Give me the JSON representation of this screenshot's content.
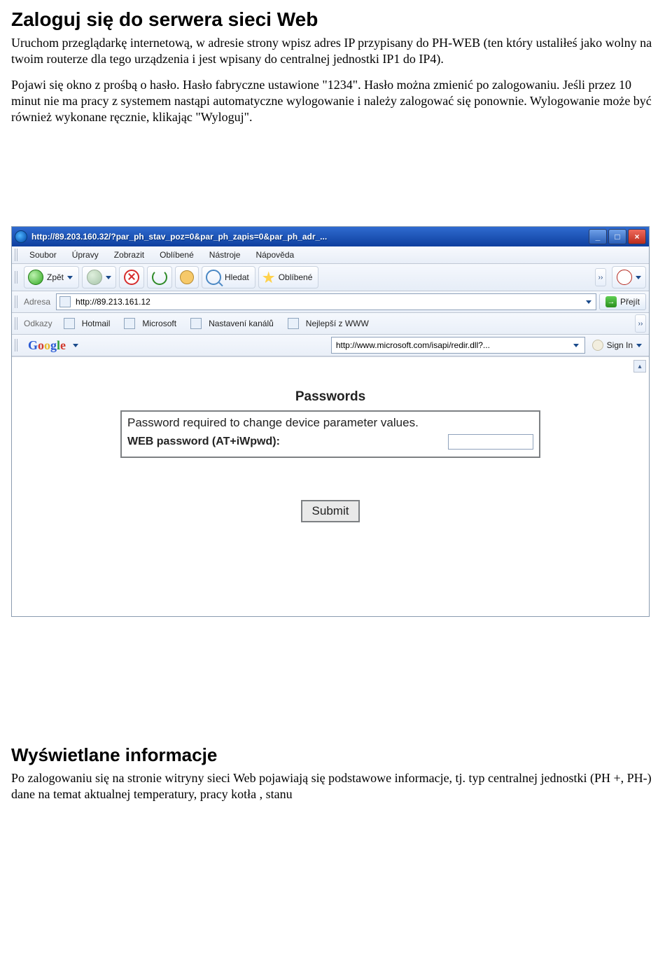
{
  "heading1": "Zaloguj się do serwera sieci Web",
  "paragraph1": "Uruchom przeglądarkę internetową, w adresie strony wpisz adres IP przypisany do PH-WEB (ten który ustaliłeś jako wolny na twoim routerze dla tego urządzenia i jest wpisany do centralnej jednostki  IP1 do IP4).",
  "paragraph2": "Pojawi się okno z prośbą o hasło. Hasło fabryczne ustawione \"1234\". Hasło można zmienić po zalogowaniu. Jeśli  przez 10 minut nie ma pracy z systemem nastąpi automatyczne wylogowanie i należy zalogować się ponownie. Wylogowanie może być również wykonane ręcznie, klikając \"Wyloguj\".",
  "browser": {
    "title": "http://89.203.160.32/?par_ph_stav_poz=0&par_ph_zapis=0&par_ph_adr_...",
    "menu": [
      "Soubor",
      "Úpravy",
      "Zobrazit",
      "Oblíbené",
      "Nástroje",
      "Nápověda"
    ],
    "back": "Zpět",
    "search": "Hledat",
    "favorites": "Oblíbené",
    "addr_label": "Adresa",
    "addr_value": "http://89.213.161.12",
    "go": "Přejít",
    "links_label": "Odkazy",
    "links": [
      "Hotmail",
      "Microsoft",
      "Nastavení kanálů",
      "Nejlepší z WWW"
    ],
    "google_value": "http://www.microsoft.com/isapi/redir.dll?...",
    "signin": "Sign In"
  },
  "passwords": {
    "title": "Passwords",
    "desc": "Password required to change device parameter values.",
    "label": "WEB password (AT+iWpwd):",
    "submit": "Submit"
  },
  "heading2": "Wyświetlane informacje",
  "paragraph3": "Po zalogowaniu się na stronie witryny sieci Web pojawiają się podstawowe informacje, tj. typ centralnej jednostki (PH +, PH-) dane na temat aktualnej temperatury, pracy kotła , stanu"
}
